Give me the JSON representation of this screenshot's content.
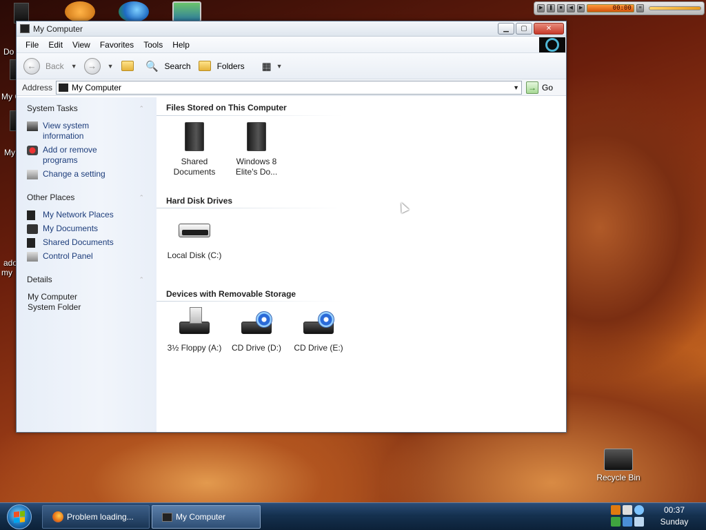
{
  "desktop": {
    "left_fragments": [
      "Do",
      "My C",
      "My F",
      "ado",
      "my"
    ],
    "recycle_bin_label": "Recycle Bin"
  },
  "media_player": {
    "time": "00:00"
  },
  "window": {
    "title": "My Computer",
    "controls": {
      "minimize": "▁",
      "maximize": "▢",
      "close": "✕"
    },
    "menu": [
      "File",
      "Edit",
      "View",
      "Favorites",
      "Tools",
      "Help"
    ],
    "toolbar": {
      "back_label": "Back",
      "search_label": "Search",
      "folders_label": "Folders"
    },
    "address": {
      "label": "Address",
      "value": "My Computer",
      "go_label": "Go"
    },
    "taskpane": {
      "system_tasks": {
        "title": "System Tasks",
        "items": [
          "View system information",
          "Add or remove programs",
          "Change a setting"
        ]
      },
      "other_places": {
        "title": "Other Places",
        "items": [
          "My Network Places",
          "My Documents",
          "Shared Documents",
          "Control Panel"
        ]
      },
      "details": {
        "title": "Details",
        "name": "My Computer",
        "type": "System Folder"
      }
    },
    "sections": {
      "files_stored": {
        "title": "Files Stored on This Computer",
        "items": [
          "Shared Documents",
          "Windows 8 Elite's Do..."
        ]
      },
      "hard_disks": {
        "title": "Hard Disk Drives",
        "items": [
          "Local Disk (C:)"
        ]
      },
      "removable": {
        "title": "Devices with Removable Storage",
        "items": [
          "3½ Floppy (A:)",
          "CD Drive (D:)",
          "CD Drive (E:)"
        ]
      }
    }
  },
  "taskbar": {
    "buttons": [
      "Problem loading...",
      "My Computer"
    ],
    "clock_time": "00:37",
    "clock_day": "Sunday"
  }
}
